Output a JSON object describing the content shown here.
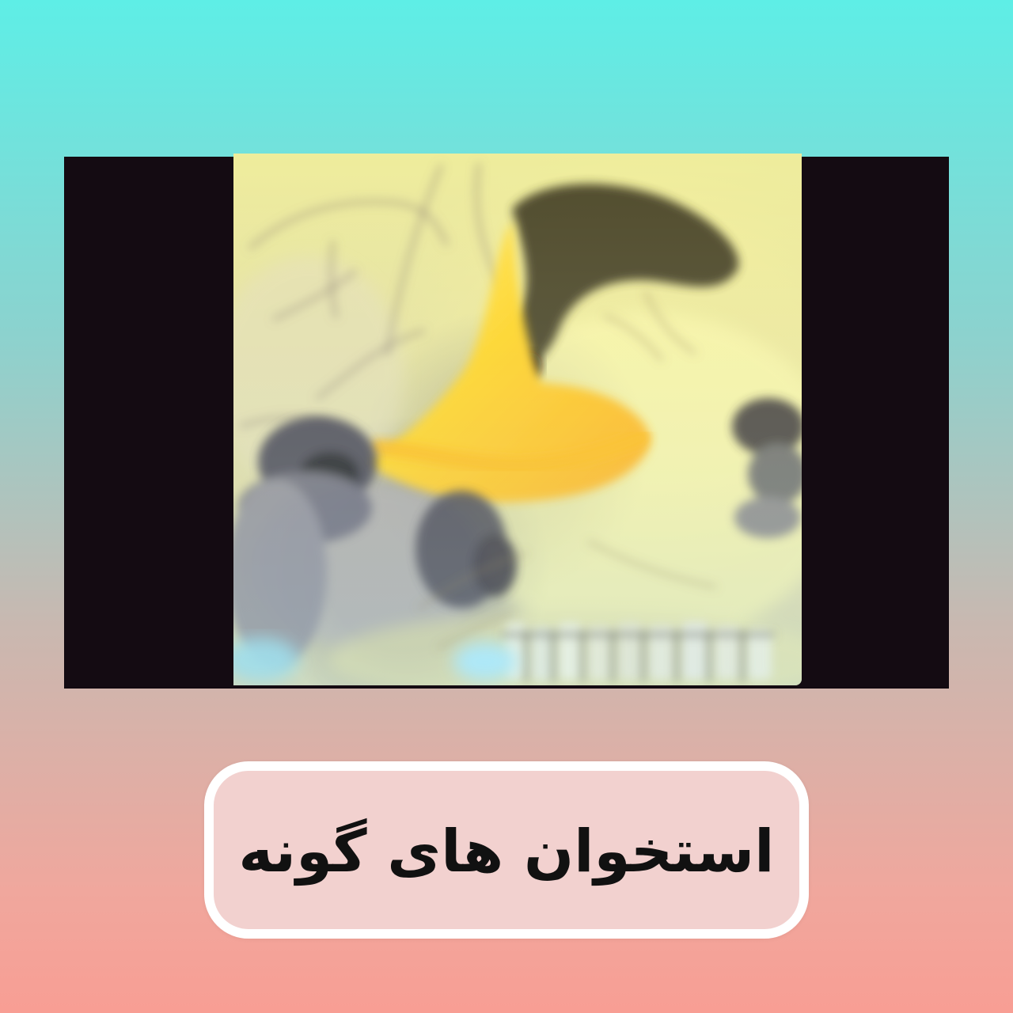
{
  "scene": {
    "background_top": "#5eeee6",
    "background_bottom": "#f89e94",
    "frame_color": "#140b12"
  },
  "image": {
    "icon": "skull-illustration",
    "highlight_color": "#f6c21a",
    "caption": "استخوان های گونه"
  }
}
